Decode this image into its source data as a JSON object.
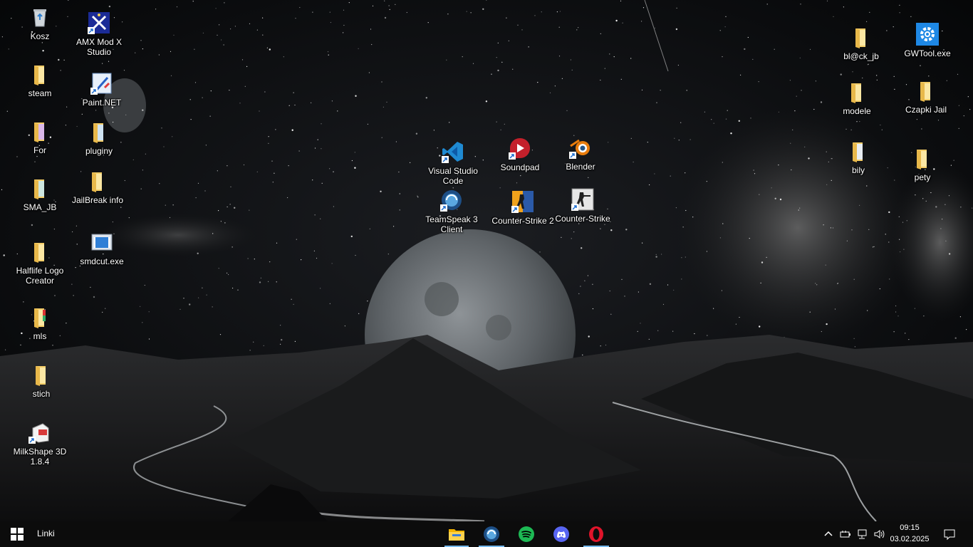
{
  "desktop_icons": {
    "kosz": "Kosz",
    "amx": "AMX Mod X Studio",
    "steam": "steam",
    "paintnet": "Paint.NET",
    "for": "For",
    "pluginy": "pluginy",
    "sma_jb": "SMA_JB",
    "jailbreak_info": "JailBreak info",
    "halflife_logo": "Halflife Logo Creator",
    "smdcut": "smdcut.exe",
    "mls": "mls",
    "stich": "stich",
    "milkshape": "MilkShape 3D 1.8.4",
    "vscode": "Visual Studio Code",
    "soundpad": "Soundpad",
    "blender": "Blender",
    "teamspeak": "TeamSpeak 3 Client",
    "cs2": "Counter-Strike 2",
    "counterstrike": "Counter-Strike",
    "blck_jb": "bl@ck_jb",
    "gwtool": "GWTool.exe",
    "modele": "modele",
    "czapki": "Czapki Jail",
    "bily": "bily",
    "pety": "pety"
  },
  "taskbar": {
    "toolbar_label": "Linki",
    "pinned": [
      "File Explorer",
      "TeamSpeak 3",
      "Spotify",
      "Discord",
      "Opera"
    ],
    "clock_time": "09:15",
    "clock_date": "03.02.2025"
  },
  "colors": {
    "taskbar_bg": "#0c0c0c",
    "accent": "#76b9ed",
    "folder": "#f4cd67"
  }
}
